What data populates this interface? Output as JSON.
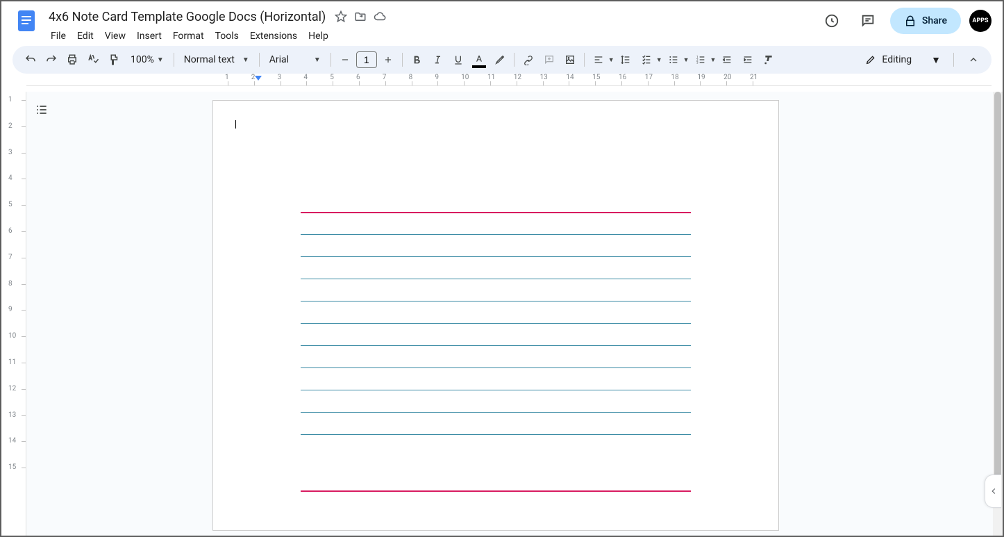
{
  "header": {
    "doc_title": "4x6 Note Card Template Google Docs (Horizontal)",
    "share_label": "Share",
    "avatar_text": "APPS"
  },
  "menu": {
    "items": [
      "File",
      "Edit",
      "View",
      "Insert",
      "Format",
      "Tools",
      "Extensions",
      "Help"
    ]
  },
  "toolbar": {
    "zoom": "100%",
    "style": "Normal text",
    "font": "Arial",
    "font_size": "1",
    "editing_label": "Editing",
    "text_color": "#000000"
  },
  "ruler": {
    "h_numbers": [
      "1",
      "2",
      "3",
      "4",
      "5",
      "6",
      "7",
      "8",
      "9",
      "10",
      "11",
      "12",
      "13",
      "14",
      "15",
      "16",
      "17",
      "18",
      "19",
      "20",
      "21"
    ],
    "v_numbers": [
      "1",
      "2",
      "3",
      "4",
      "5",
      "6",
      "7",
      "8",
      "9",
      "10",
      "11",
      "12",
      "13",
      "14",
      "15"
    ]
  },
  "notecard": {
    "top_line_color": "#d81b60",
    "rule_line_color": "#3b8ba5",
    "bottom_line_color": "#d81b60",
    "rule_line_count": 10
  }
}
